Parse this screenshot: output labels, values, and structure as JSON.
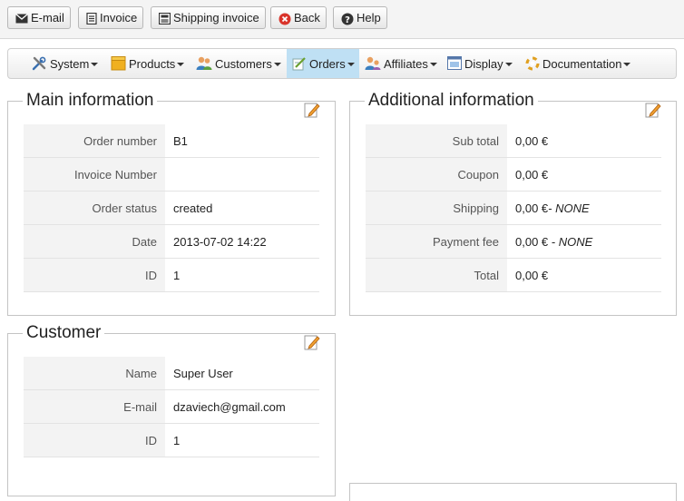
{
  "toolbar": {
    "email_label": "E-mail",
    "invoice_label": "Invoice",
    "shipping_invoice_label": "Shipping invoice",
    "back_label": "Back",
    "help_label": "Help"
  },
  "menu": {
    "system": "System",
    "products": "Products",
    "customers": "Customers",
    "orders": "Orders",
    "affiliates": "Affiliates",
    "display": "Display",
    "documentation": "Documentation"
  },
  "main_info": {
    "title": "Main information",
    "rows": [
      {
        "label": "Order number",
        "value": "B1"
      },
      {
        "label": "Invoice Number",
        "value": ""
      },
      {
        "label": "Order status",
        "value": "created"
      },
      {
        "label": "Date",
        "value": "2013-07-02 14:22"
      },
      {
        "label": "ID",
        "value": "1"
      }
    ]
  },
  "additional_info": {
    "title": "Additional information",
    "rows": [
      {
        "label": "Sub total",
        "value": "0,00 €",
        "note": ""
      },
      {
        "label": "Coupon",
        "value": "0,00 €",
        "note": ""
      },
      {
        "label": "Shipping",
        "value": "0,00 €",
        "note": "- NONE"
      },
      {
        "label": "Payment fee",
        "value": "0,00 € ",
        "note": "- NONE"
      },
      {
        "label": "Total",
        "value": "0,00 €",
        "note": ""
      }
    ]
  },
  "customer": {
    "title": "Customer",
    "rows": [
      {
        "label": "Name",
        "value": "Super User"
      },
      {
        "label": "E-mail",
        "value": "dzaviech@gmail.com"
      },
      {
        "label": "ID",
        "value": "1"
      }
    ]
  },
  "colors": {
    "active_menu": "#bfe0f4",
    "back_icon": "#d9342b"
  },
  "icons": {
    "email": "envelope-icon",
    "invoice": "document-icon",
    "shipping_invoice": "printer-icon",
    "back": "close-circle-icon",
    "help": "question-circle-icon",
    "edit": "edit-pencil-icon"
  }
}
